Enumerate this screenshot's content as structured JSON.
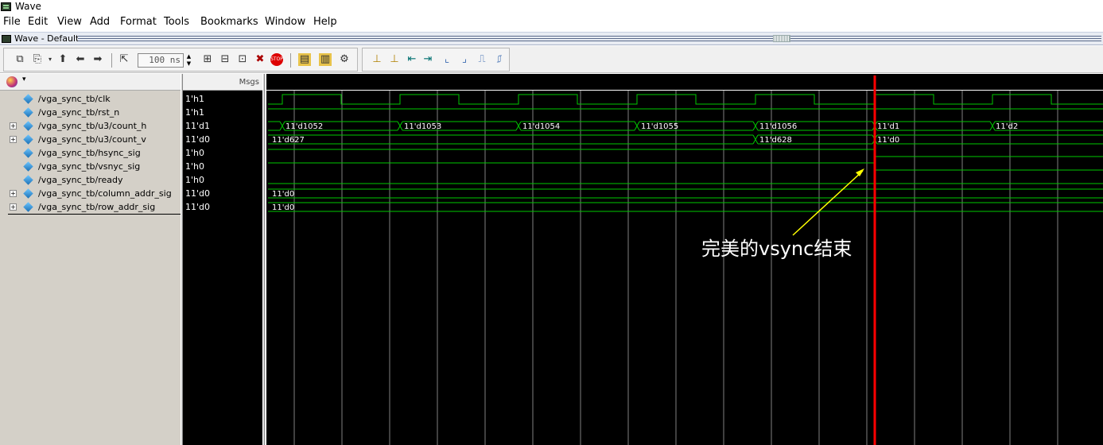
{
  "window": {
    "title": "Wave"
  },
  "menu": [
    "File",
    "Edit",
    "View",
    "Add",
    "Format",
    "Tools",
    "Bookmarks",
    "Window",
    "Help"
  ],
  "panel": {
    "title": "Wave - Default"
  },
  "toolbar": {
    "time_value": "100 ns",
    "icons": [
      "wave-snapshot-icon",
      "copy-icon",
      "arrow-up-icon",
      "arrow-left-icon",
      "arrow-right-icon",
      "zoom-fit-icon",
      "zoom-in-icon",
      "zoom-out-icon",
      "zoom-range-icon",
      "delete-cursor-icon",
      "stop-icon",
      "run-icon",
      "continue-icon",
      "step-icon",
      "expand-icon",
      "find-edge-up-icon",
      "find-edge-down-icon",
      "prev-transition-icon",
      "next-transition-icon",
      "prev-edge-icon",
      "next-edge-icon",
      "fall-edge-icon",
      "rise-edge-icon"
    ]
  },
  "header": {
    "msgs_label": "Msgs"
  },
  "signals": [
    {
      "name": "/vga_sync_tb/clk",
      "value": "1'h1",
      "expandable": false,
      "type": "clock"
    },
    {
      "name": "/vga_sync_tb/rst_n",
      "value": "1'h1",
      "expandable": false,
      "type": "high"
    },
    {
      "name": "/vga_sync_tb/u3/count_h",
      "value": "11'd1",
      "expandable": true,
      "type": "bus",
      "labels": [
        "11'd1052",
        "11'd1053",
        "11'd1054",
        "11'd1055",
        "11'd1056",
        "11'd1",
        "11'd2"
      ]
    },
    {
      "name": "/vga_sync_tb/u3/count_v",
      "value": "11'd0",
      "expandable": true,
      "type": "bus",
      "labels": [
        "11'd627",
        "11'd628",
        "11'd0"
      ]
    },
    {
      "name": "/vga_sync_tb/hsync_sig",
      "value": "1'h0",
      "expandable": false,
      "type": "falls"
    },
    {
      "name": "/vga_sync_tb/vsnyc_sig",
      "value": "1'h0",
      "expandable": false,
      "type": "falls"
    },
    {
      "name": "/vga_sync_tb/ready",
      "value": "1'h0",
      "expandable": false,
      "type": "low"
    },
    {
      "name": "/vga_sync_tb/column_addr_sig",
      "value": "11'd0",
      "expandable": true,
      "type": "bus",
      "labels": [
        "11'd0"
      ]
    },
    {
      "name": "/vga_sync_tb/row_addr_sig",
      "value": "11'd0",
      "expandable": true,
      "type": "bus",
      "labels": [
        "11'd0"
      ]
    }
  ],
  "annotation": {
    "text": "完美的vsync结束"
  },
  "colors": {
    "wave": "#00c800",
    "cursor": "#ff0000",
    "arrow": "#ffff00",
    "grid": "#808080"
  }
}
